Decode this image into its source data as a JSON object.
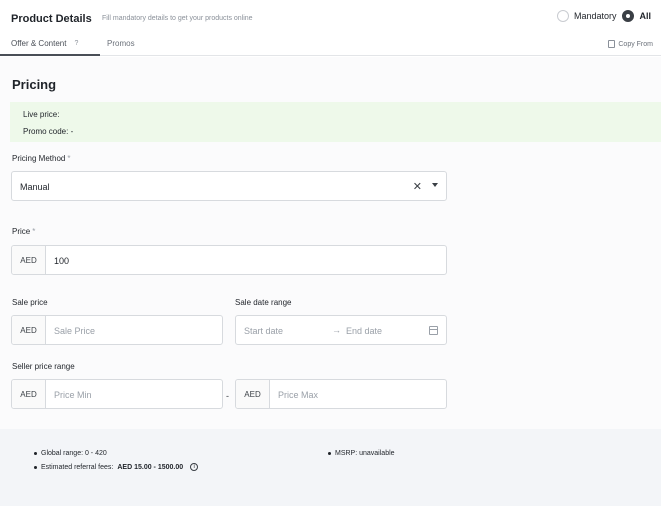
{
  "header": {
    "title": "Product Details",
    "subtitle": "Fill mandatory details to get your products online",
    "filter_options": [
      {
        "label": "Mandatory",
        "selected": false
      },
      {
        "label": "All",
        "selected": true
      }
    ]
  },
  "tabs": [
    {
      "label": "Offer & Content",
      "badge": "?",
      "active": true
    },
    {
      "label": "Promos",
      "active": false
    }
  ],
  "copy_from": "Copy From",
  "pricing": {
    "title": "Pricing",
    "info": {
      "live_price": "Live price:",
      "promo_code": "Promo code: -"
    },
    "pricing_method": {
      "label": "Pricing Method",
      "required_mark": "*",
      "value": "Manual",
      "clear_glyph": "✕"
    },
    "price": {
      "label": "Price",
      "required_mark": "*",
      "currency": "AED",
      "value": "100"
    },
    "sale_price": {
      "label": "Sale price",
      "currency": "AED",
      "placeholder": "Sale Price"
    },
    "sale_date_range": {
      "label": "Sale date range",
      "start_placeholder": "Start date",
      "arrow": "→",
      "end_placeholder": "End date"
    },
    "seller_price_range": {
      "label": "Seller price range",
      "min": {
        "currency": "AED",
        "placeholder": "Price Min"
      },
      "separator": "-",
      "max": {
        "currency": "AED",
        "placeholder": "Price Max"
      }
    }
  },
  "footer": {
    "global_range": "Global range: 0 - 420",
    "msrp": "MSRP: unavailable",
    "referral_label": "Estimated referral fees:",
    "referral_value": "AED 15.00 - 1500.00",
    "info_glyph": "i"
  },
  "colors": {
    "info_box_bg": "#eef9ea",
    "footer_bg": "#f3f5f8",
    "border": "#d7dade"
  }
}
